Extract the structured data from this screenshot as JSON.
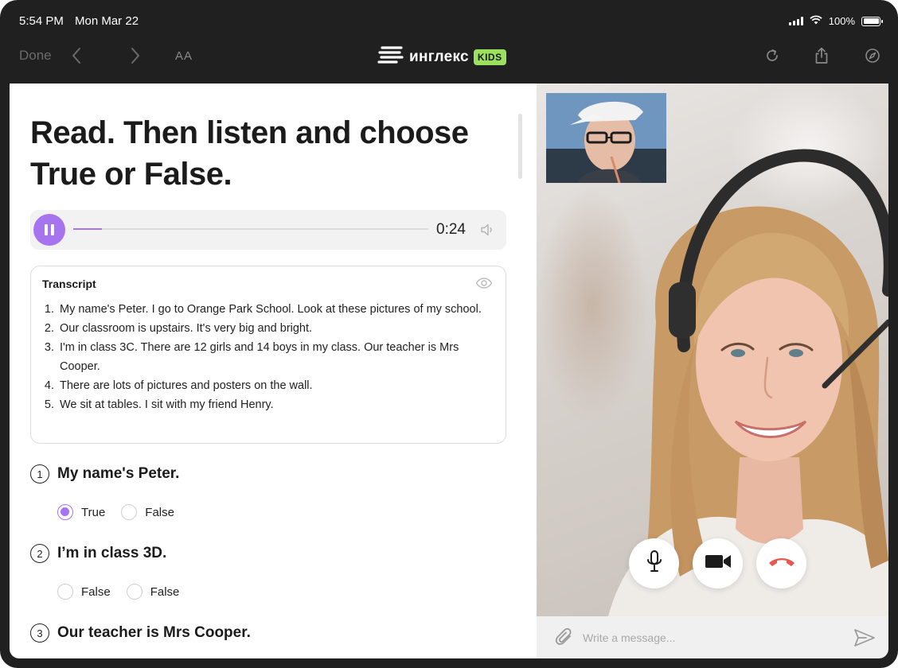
{
  "status_bar": {
    "time": "5:54 PM",
    "date": "Mon Mar 22",
    "battery": "100%"
  },
  "toolbar": {
    "done_label": "Done",
    "text_size_label": "AA",
    "logo_text": "инглекс",
    "logo_badge": "KIDS"
  },
  "exercise": {
    "title": "Read. Then listen and choose True or False.",
    "player": {
      "time": "0:24",
      "progress": 0.08,
      "state": "playing"
    },
    "transcript": {
      "heading": "Transcript",
      "lines": [
        {
          "n": "1.",
          "text": "My name's Peter. I go to Orange Park School. Look at these pictures of my school."
        },
        {
          "n": "2.",
          "text": "Our classroom is upstairs. It's very big and bright."
        },
        {
          "n": "3.",
          "text": "I'm in class 3C. There are 12 girls and 14 boys in my class. Our teacher is Mrs Cooper."
        },
        {
          "n": "4.",
          "text": "There are lots of pictures and posters on the wall."
        },
        {
          "n": "5.",
          "text": "We sit at tables. I sit with my friend Henry."
        }
      ]
    },
    "questions": [
      {
        "num": "1",
        "text": "My name's Peter.",
        "options": [
          "True",
          "False"
        ],
        "selected": "True"
      },
      {
        "num": "2",
        "text": "I’m in class 3D.",
        "options": [
          "False",
          "False"
        ],
        "selected": null
      },
      {
        "num": "3",
        "text": "Our teacher is Mrs Cooper.",
        "options": [],
        "selected": null
      }
    ]
  },
  "video_call": {
    "controls": [
      "microphone-icon",
      "camera-icon",
      "end-call-icon"
    ],
    "end_call_color": "#e8584f"
  },
  "chat": {
    "placeholder": "Write a message..."
  },
  "colors": {
    "accent": "#a774f0",
    "badge": "#9be15d",
    "chrome": "#202020"
  }
}
